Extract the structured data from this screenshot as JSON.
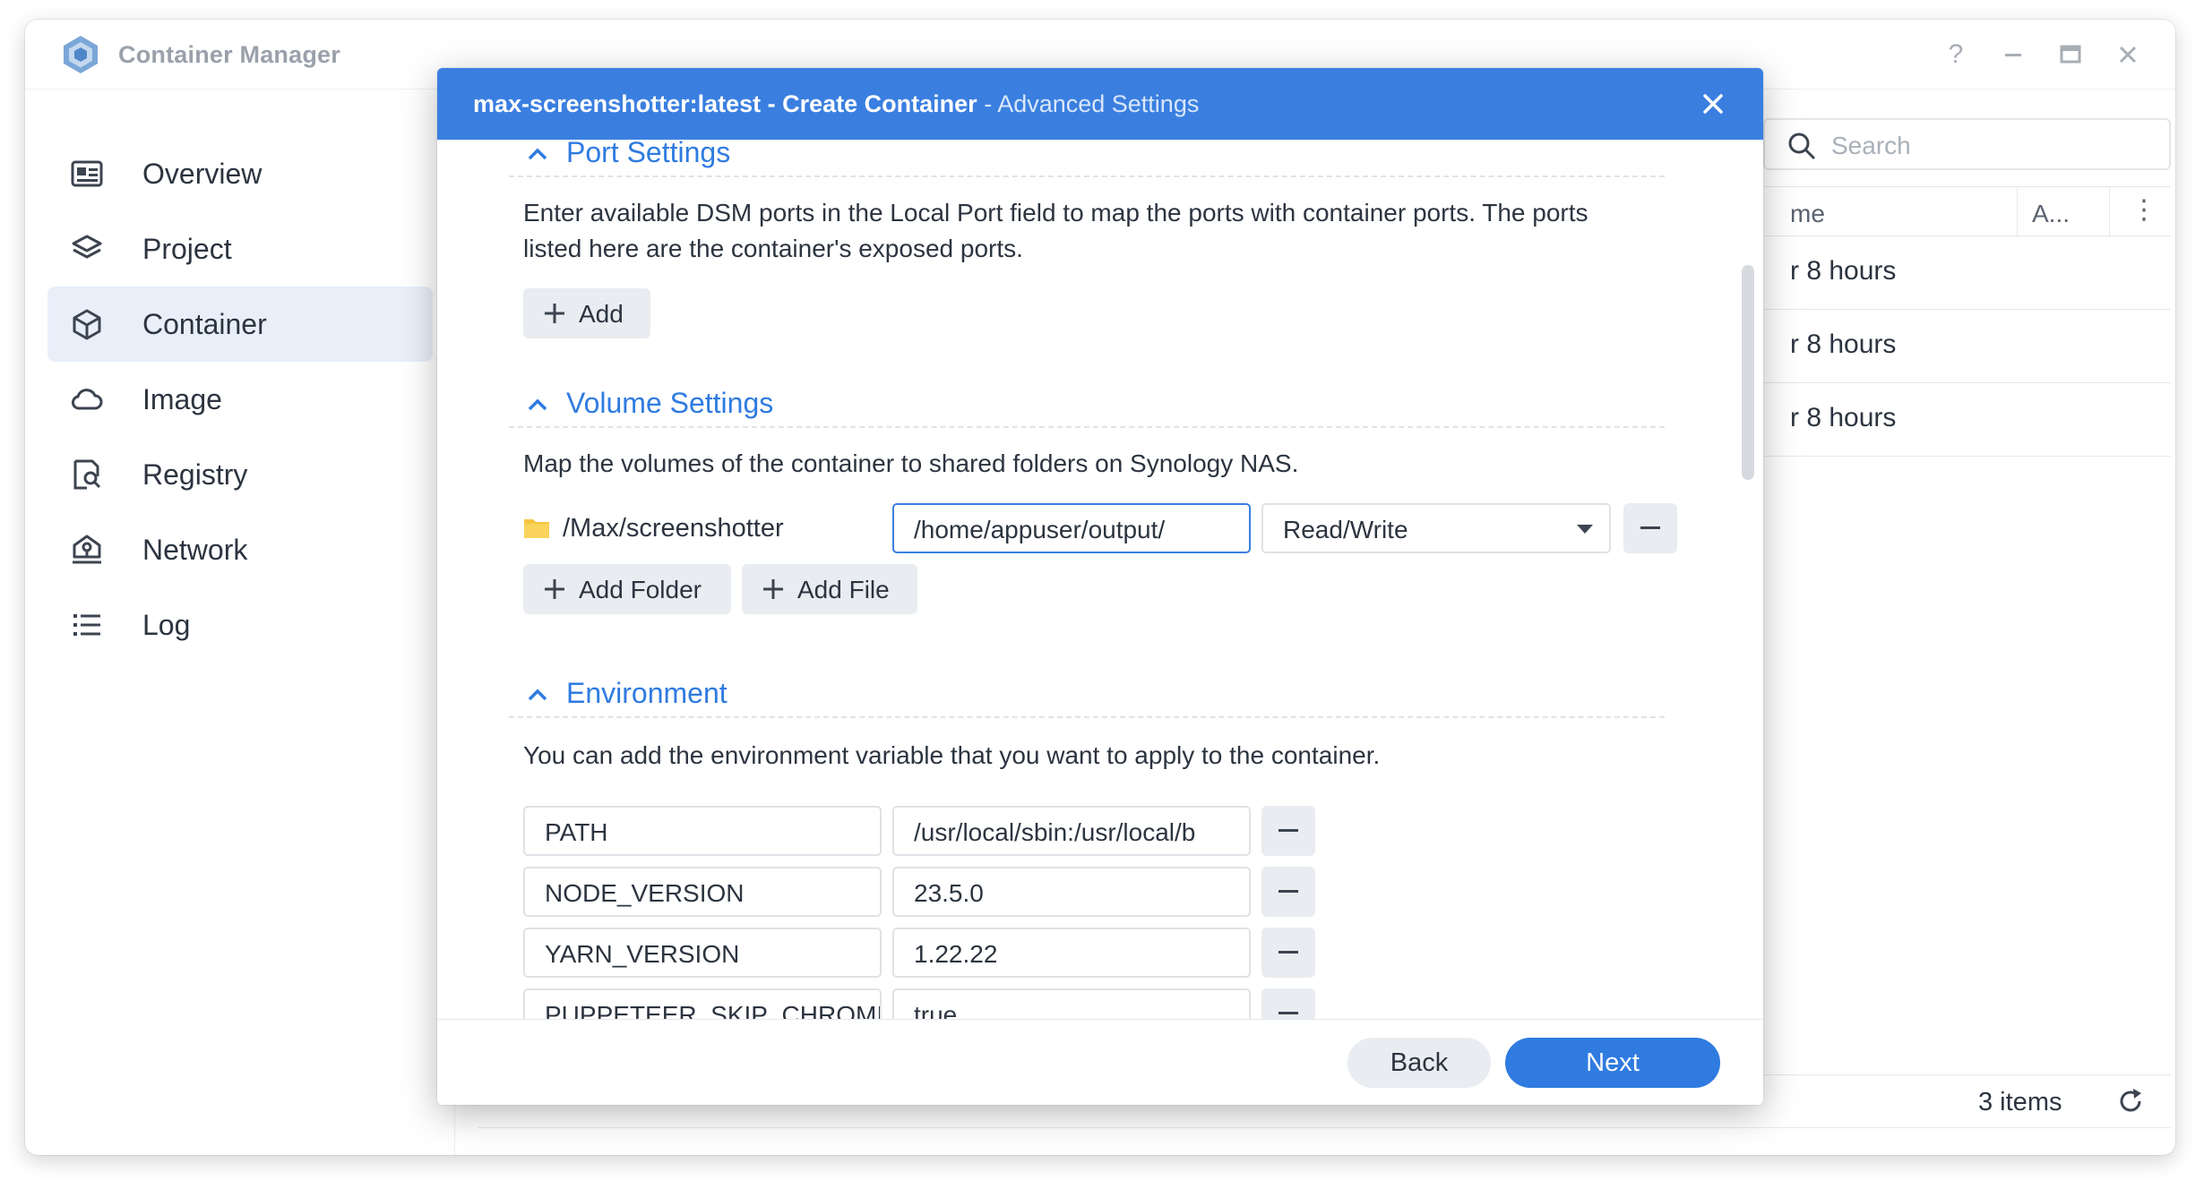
{
  "app": {
    "title": "Container Manager",
    "window_controls": {
      "help": "?",
      "minimize": "–",
      "maximize": "□",
      "close": "×"
    }
  },
  "sidebar": {
    "items": [
      {
        "label": "Overview",
        "icon": "overview-icon",
        "active": false
      },
      {
        "label": "Project",
        "icon": "layers-icon",
        "active": false
      },
      {
        "label": "Container",
        "icon": "cube-icon",
        "active": true
      },
      {
        "label": "Image",
        "icon": "cloud-icon",
        "active": false
      },
      {
        "label": "Registry",
        "icon": "registry-search-icon",
        "active": false
      },
      {
        "label": "Network",
        "icon": "network-house-icon",
        "active": false
      },
      {
        "label": "Log",
        "icon": "list-icon",
        "active": false
      }
    ]
  },
  "background_list": {
    "search_placeholder": "Search",
    "columns": {
      "name": "me",
      "a": "A...",
      "more": "⋮"
    },
    "rows": [
      "r 8 hours",
      "r 8 hours",
      "r 8 hours"
    ],
    "items_count": "3 items"
  },
  "dialog": {
    "title_bold": "max-screenshotter:latest - Create Container",
    "title_sub": " - Advanced Settings",
    "port": {
      "title": "Port Settings",
      "description": "Enter available DSM ports in the Local Port field to map the ports with container ports. The ports listed here are the container's exposed ports.",
      "add_label": "Add"
    },
    "volume": {
      "title": "Volume Settings",
      "description": "Map the volumes of the container to shared folders on Synology NAS.",
      "folder": "/Max/screenshotter",
      "mount_path": "/home/appuser/output/",
      "permission": "Read/Write",
      "add_folder_label": "Add Folder",
      "add_file_label": "Add File"
    },
    "environment": {
      "title": "Environment",
      "description": "You can add the environment variable that you want to apply to the container.",
      "vars": [
        {
          "key": "PATH",
          "value": "/usr/local/sbin:/usr/local/b"
        },
        {
          "key": "NODE_VERSION",
          "value": "23.5.0"
        },
        {
          "key": "YARN_VERSION",
          "value": "1.22.22"
        },
        {
          "key": "PUPPETEER_SKIP_CHROMI",
          "value": "true"
        }
      ]
    },
    "footer": {
      "back_label": "Back",
      "next_label": "Next"
    }
  },
  "colors": {
    "accent": "#3a7fe0",
    "section_title": "#2f7be0",
    "active_nav_bg": "#e8eff9"
  }
}
